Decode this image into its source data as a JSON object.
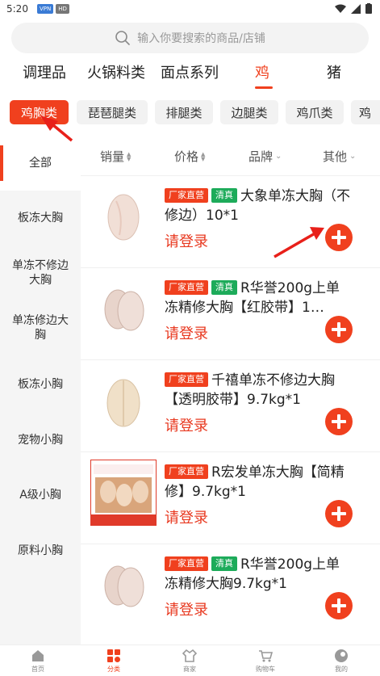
{
  "status": {
    "time": "5:20",
    "badges": [
      "VPN",
      "HD"
    ]
  },
  "search": {
    "placeholder": "输入你要搜索的商品/店铺"
  },
  "categories": [
    "调理品",
    "火锅料类",
    "面点系列",
    "鸡",
    "猪"
  ],
  "active_category": "鸡",
  "sub_tags": [
    "鸡胸类",
    "琵琶腿类",
    "排腿类",
    "边腿类",
    "鸡爪类",
    "鸡"
  ],
  "sidebar": [
    "全部",
    "板冻大胸",
    "单冻不修边大胸",
    "单冻修边大胸",
    "板冻小胸",
    "宠物小胸",
    "A级小胸",
    "原料小胸"
  ],
  "sort": {
    "sales": "销量",
    "price": "价格",
    "brand": "品牌",
    "other": "其他"
  },
  "tags": {
    "direct": "厂家直营",
    "halal": "清真"
  },
  "login_label": "请登录",
  "products": [
    {
      "title": "大象单冻大胸（不修边）10*1",
      "halal": true
    },
    {
      "title": "R华誉200g上单冻精修大胸【红胶带】1…",
      "halal": true
    },
    {
      "title": "千禧单冻不修边大胸【透明胶带】9.7kg*1",
      "halal": false
    },
    {
      "title": "R宏发单冻大胸【简精修】9.7kg*1",
      "halal": false
    },
    {
      "title": "R华誉200g上单冻精修大胸9.7kg*1",
      "halal": true
    }
  ],
  "bottom_nav": [
    "首页",
    "分类",
    "商家",
    "购物车",
    "我的"
  ],
  "colors": {
    "accent": "#f0401e",
    "halal": "#1dab5a"
  }
}
